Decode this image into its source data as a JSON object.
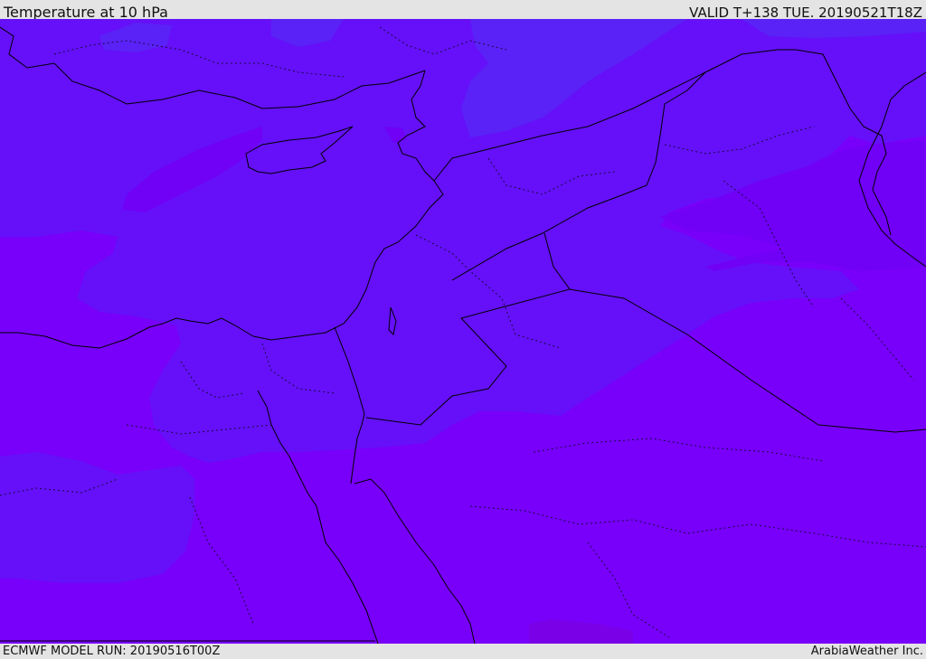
{
  "header": {
    "title": "Temperature at 10 hPa",
    "valid_time": "VALID T+138 TUE. 20190521T18Z"
  },
  "footer": {
    "model_run": "ECMWF MODEL RUN: 20190516T00Z",
    "credit": "ArabiaWeather Inc."
  },
  "colors": {
    "band_cold": "#7800fa",
    "band_mid": "#6510f8",
    "band_warm": "#5a22f6",
    "band_warmest": "#5530f0",
    "band_coldest": "#7a00e8",
    "coastline": "#000000",
    "border": "#000000",
    "internal_border": "#1a0a40"
  }
}
